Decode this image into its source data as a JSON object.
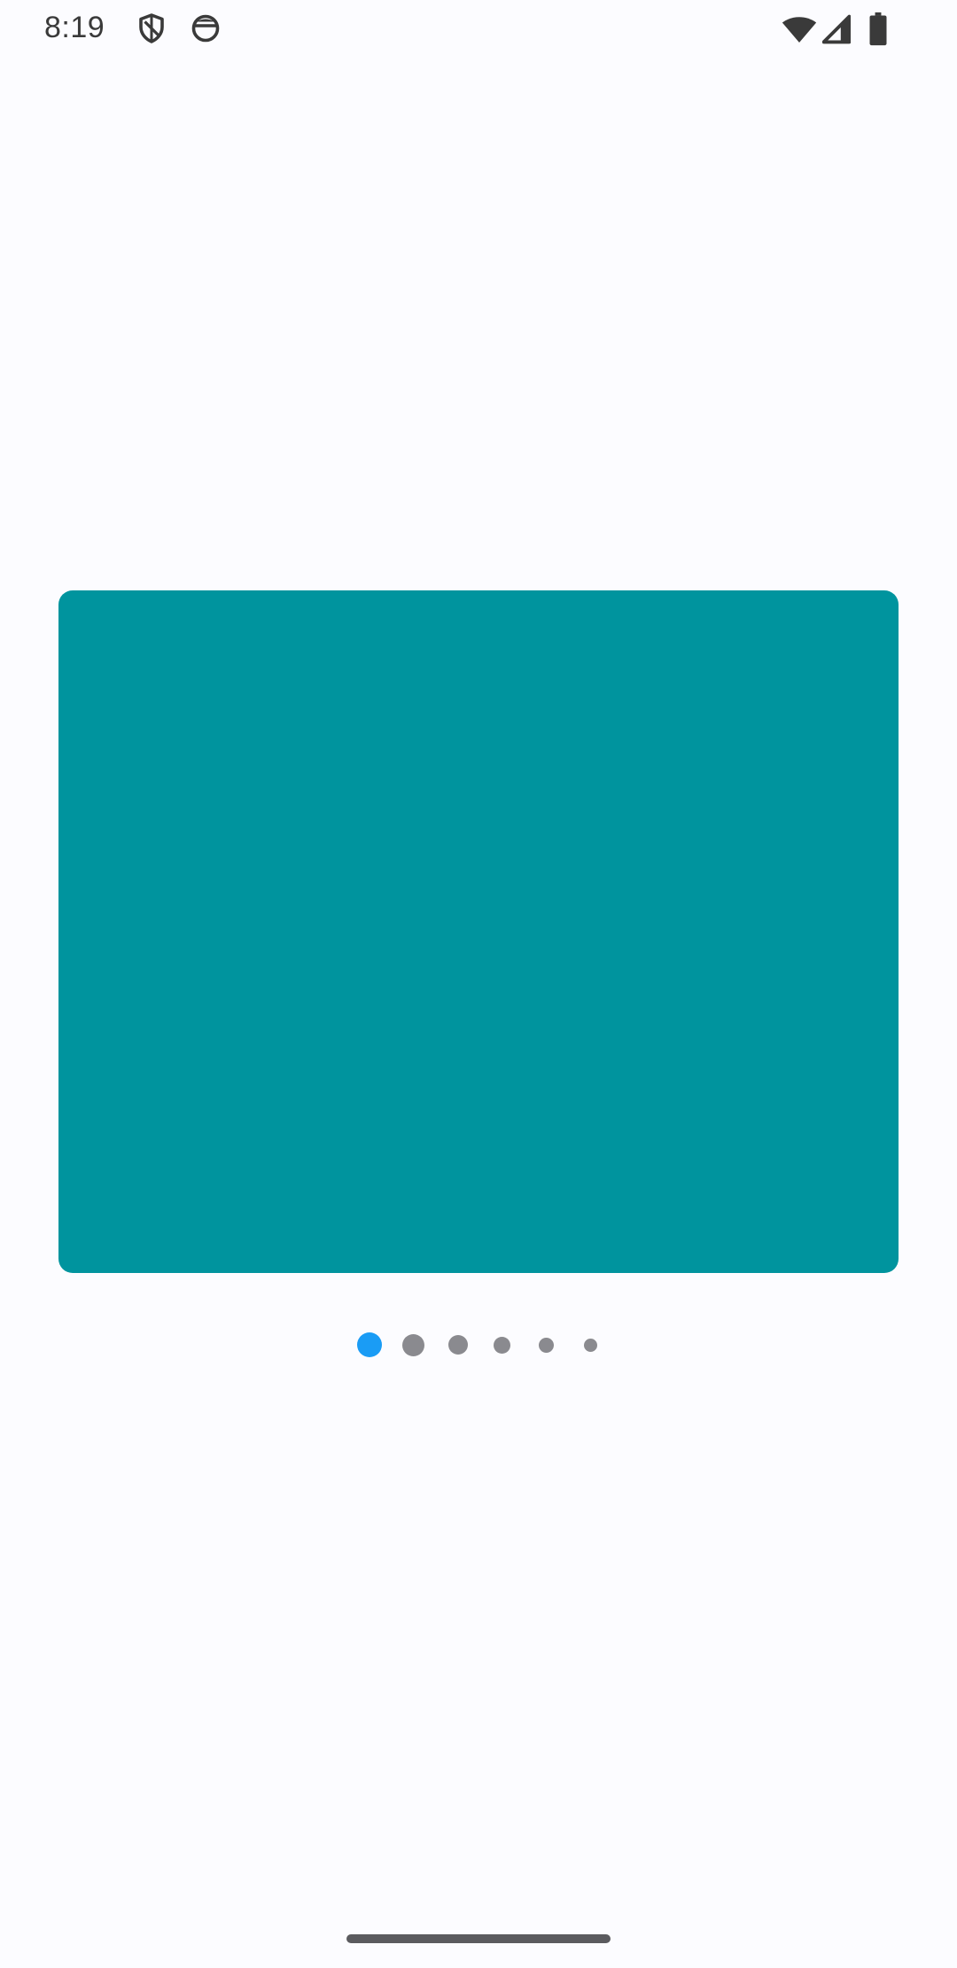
{
  "status_bar": {
    "time": "8:19",
    "icons": [
      "shield-icon",
      "droid-icon",
      "wifi-icon",
      "signal-icon",
      "battery-icon"
    ]
  },
  "carousel": {
    "slide_color": "#00949e",
    "page_count": 6,
    "active_index": 0
  },
  "colors": {
    "background": "#fcfcff",
    "indicator_active": "#1a9cf5",
    "indicator_inactive": "#8a8a8f",
    "gesture_bar": "#5b5b5f"
  }
}
